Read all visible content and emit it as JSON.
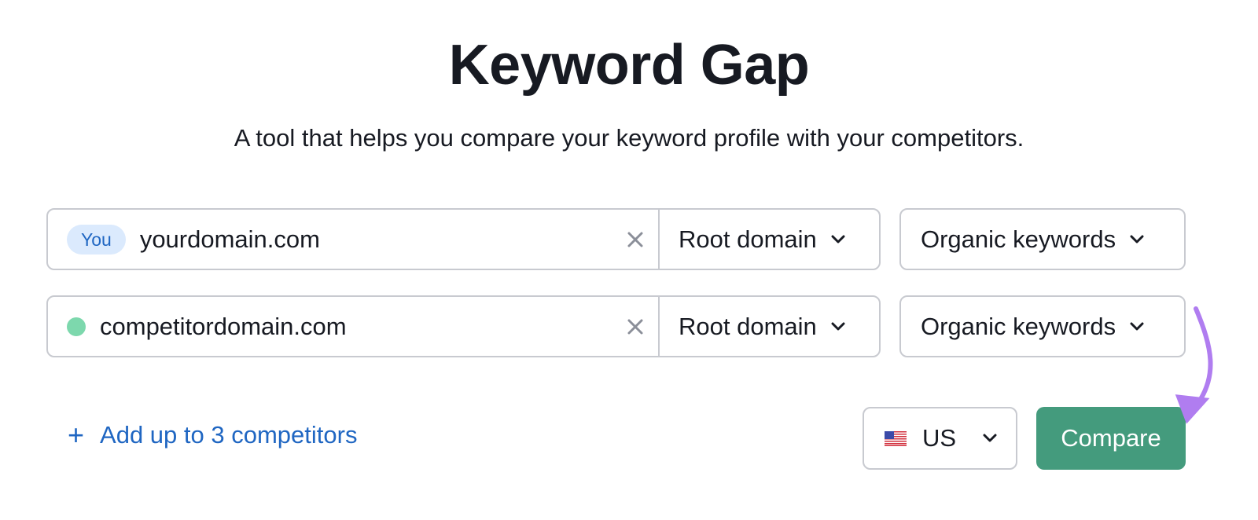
{
  "header": {
    "title": "Keyword Gap",
    "subtitle": "A tool that helps you compare your keyword profile with your competitors."
  },
  "domains": [
    {
      "badge": "You",
      "marker": "you-badge",
      "value": "yourdomain.com",
      "scope": "Root domain",
      "keyword_type": "Organic keywords"
    },
    {
      "badge": null,
      "marker": "green-dot",
      "marker_color": "#7dd8ad",
      "value": "competitordomain.com",
      "scope": "Root domain",
      "keyword_type": "Organic keywords"
    }
  ],
  "add_competitors": {
    "icon": "plus-icon",
    "label": "Add up to 3 competitors"
  },
  "country": {
    "flag": "us-flag-icon",
    "value": "US"
  },
  "compare_button": {
    "label": "Compare"
  },
  "icons": {
    "clear": "close-icon",
    "dropdown": "chevron-down-icon",
    "annotation": "curved-arrow-icon"
  },
  "colors": {
    "accent_blue": "#1f66c2",
    "badge_bg": "#dbeafd",
    "compare_green": "#449b7d",
    "competitor_dot": "#7dd8ad",
    "annotation_purple": "#b07df0",
    "border": "#c8cad0"
  }
}
